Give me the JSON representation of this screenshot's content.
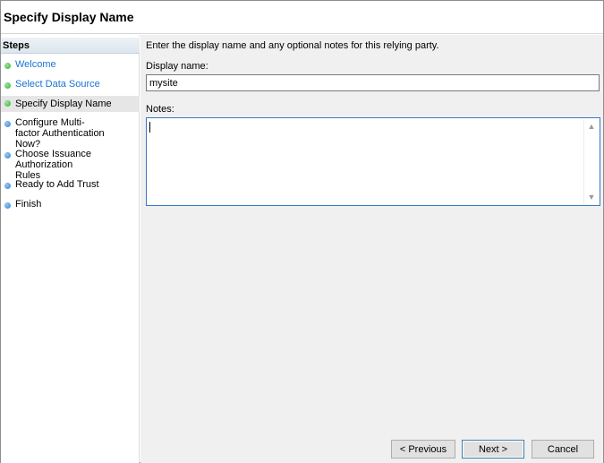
{
  "header": {
    "title": "Specify Display Name"
  },
  "sidebar": {
    "heading": "Steps",
    "steps": [
      {
        "label": "Welcome",
        "status": "done",
        "style": "link"
      },
      {
        "label": "Select Data Source",
        "status": "done",
        "style": "link"
      },
      {
        "label": "Specify Display Name",
        "status": "done",
        "style": "current"
      },
      {
        "label": "Configure Multi-factor Authentication Now?",
        "status": "pending",
        "style": "plain"
      },
      {
        "label": "Choose Issuance Authorization Rules",
        "status": "pending",
        "style": "plain"
      },
      {
        "label": "Ready to Add Trust",
        "status": "pending",
        "style": "plain"
      },
      {
        "label": "Finish",
        "status": "pending",
        "style": "plain"
      }
    ]
  },
  "main": {
    "instructions": "Enter the display name and any optional notes for this relying party.",
    "display_name_label": "Display name:",
    "display_name_value": "mysite",
    "notes_label": "Notes:",
    "notes_value": ""
  },
  "buttons": {
    "previous": "< Previous",
    "next": "Next >",
    "cancel": "Cancel"
  },
  "colors": {
    "link": "#1874d3",
    "done_dot": "#2fae2f",
    "pending_dot": "#2b7fd6",
    "focus_border": "#3a78c4"
  }
}
